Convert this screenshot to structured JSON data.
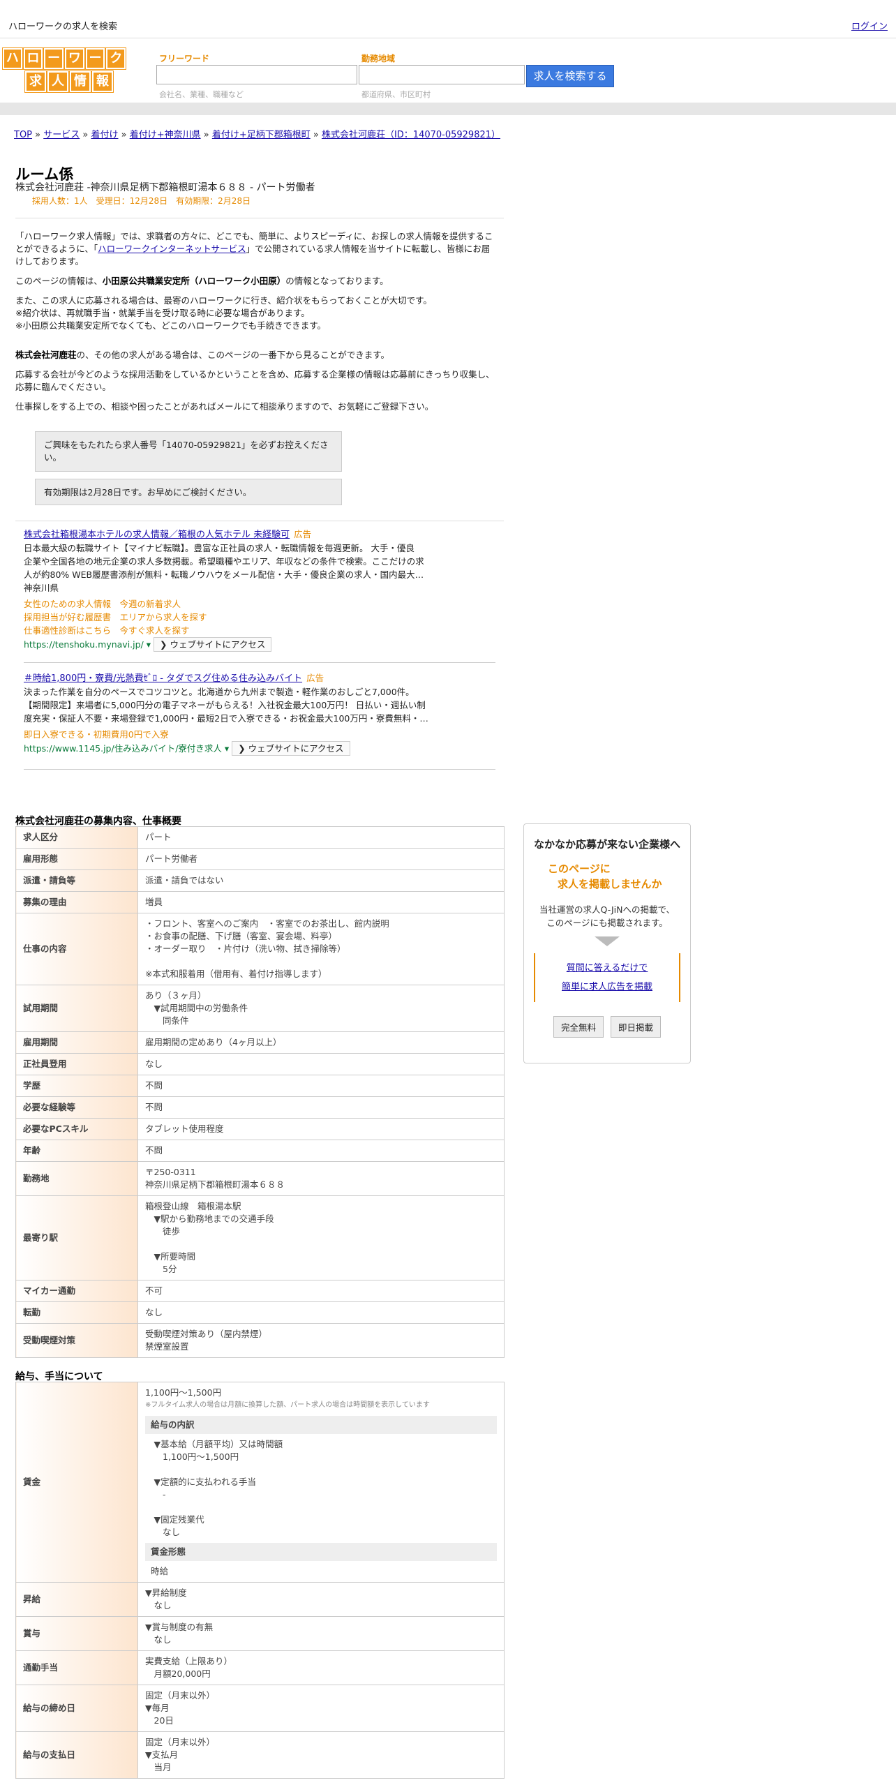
{
  "topbar": {
    "title": "ハローワークの求人を検索",
    "login": "ログイン"
  },
  "logo": {
    "row1": [
      "ハ",
      "ロ",
      "ー",
      "ワ",
      "ー",
      "ク"
    ],
    "row2": [
      "求",
      "人",
      "情",
      "報"
    ]
  },
  "search": {
    "free_label": "フリーワード",
    "free_placeholder": "会社名、業種、職種など",
    "area_label": "勤務地域",
    "area_placeholder": "都道府県、市区町村",
    "button": "求人を検索する"
  },
  "breadcrumb": {
    "items": [
      "TOP",
      "サービス",
      "着付け",
      "着付け+神奈川県",
      "着付け+足柄下郡箱根町",
      "株式会社河鹿荘（ID：14070-05929821）"
    ],
    "sep": " » "
  },
  "job": {
    "title": "ルーム係",
    "subtitle": "株式会社河鹿荘 -神奈川県足柄下郡箱根町湯本６８８ - パート労働者",
    "meta": "採用人数：1人　受理日：12月28日　有効期限：2月28日"
  },
  "intro": {
    "p1a": "「ハローワーク求人情報」では、求職者の方々に、どこでも、簡単に、よりスピーディに、お探しの求人情報を提供することができるように、「",
    "p1link": "ハローワークインターネットサービス",
    "p1b": "」で公開されている求人情報を当サイトに転載し、皆様にお届けしております。",
    "p2a": "このページの情報は、",
    "p2b": "小田原公共職業安定所（ハローワーク小田原）",
    "p2c": "の情報となっております。",
    "p3": [
      "また、この求人に応募される場合は、最寄のハローワークに行き、紹介状をもらっておくことが大切です。",
      "※紹介状は、再就職手当・就業手当を受け取る時に必要な場合があります。",
      "※小田原公共職業安定所でなくても、どこのハローワークでも手続きできます。"
    ],
    "p4a": "株式会社河鹿荘",
    "p4b": "の、その他の求人がある場合は、このページの一番下から見ることができます。",
    "p5": "応募する会社が今どのような採用活動をしているかということを含め、応募する企業様の情報は応募前にきっちり収集し、応募に臨んでください。",
    "p6": "仕事探しをする上での、相談や困ったことがあればメールにて相談承りますので、お気軽にご登録下さい。",
    "note1": "ご興味をもたれたら求人番号「14070-05929821」を必ずお控えください。",
    "note2": "有効期限は2月28日です。お早めにご検討ください。"
  },
  "ads": [
    {
      "title": "株式会社箱根湯本ホテルの求人情報／箱根の人気ホテル 未経験可",
      "tag": "広告",
      "body": [
        "日本最大級の転職サイト【マイナビ転職】。豊富な正社員の求人・転職情報を毎週更新。 大手・優良",
        "企業や全国各地の地元企業の求人多数掲載。希望職種やエリア、年収などの条件で検索。ここだけの求",
        "人が約80% WEB履歴書添削が無料・転職ノウハウをメール配信・大手・優良企業の求人・国内最大…",
        "神奈川県"
      ],
      "links": [
        "女性のための求人情報　今週の新着求人",
        "採用担当が好む履歴書　エリアから求人を探す",
        "仕事適性診断はこちら　今すぐ求人を探す"
      ],
      "url": "https://tenshoku.mynavi.jp/",
      "access": "❯ ウェブサイトにアクセス"
    },
    {
      "title": "＃時給1,800円・寮費/光熱費ｾﾞﾛ - タダでスグ住める住み込みバイト",
      "tag": "広告",
      "body": [
        "決まった作業を自分のペースでコツコツと。北海道から九州まで製造・軽作業のおしごと7,000件。",
        "【期間限定】来場者に5,000円分の電子マネーがもらえる！入社祝金最大100万円！ 日払い・週払い制",
        "度充実・保証人不要・来場登録で1,000円・最短2日で入寮できる・お祝金最大100万円・寮費無料・…"
      ],
      "links": [
        "即日入寮できる・初期費用0円で入寮"
      ],
      "url": "https://www.1145.jp/住み込みバイト/寮付き求人",
      "access": "❯ ウェブサイトにアクセス"
    }
  ],
  "overview": {
    "title": "株式会社河鹿荘の募集内容、仕事概要",
    "rows": [
      {
        "k": "求人区分",
        "v": [
          "パート"
        ]
      },
      {
        "k": "雇用形態",
        "v": [
          "パート労働者"
        ]
      },
      {
        "k": "派遣・請負等",
        "v": [
          "派遣・請負ではない"
        ]
      },
      {
        "k": "募集の理由",
        "v": [
          "増員"
        ]
      },
      {
        "k": "仕事の内容",
        "v": [
          "・フロント、客室へのご案内　・客室でのお茶出し、館内説明",
          "・お食事の配膳、下げ膳（客室、宴会場、料亭）",
          "・オーダー取り　・片付け（洗い物、拭き掃除等）",
          "",
          "※本式和服着用（借用有、着付け指導します）"
        ]
      },
      {
        "k": "試用期間",
        "v": [
          "あり（３ヶ月）",
          "　▼試用期間中の労働条件",
          "　　同条件"
        ]
      },
      {
        "k": "雇用期間",
        "v": [
          "雇用期間の定めあり（4ヶ月以上）"
        ]
      },
      {
        "k": "正社員登用",
        "v": [
          "なし"
        ]
      },
      {
        "k": "学歴",
        "v": [
          "不問"
        ]
      },
      {
        "k": "必要な経験等",
        "v": [
          "不問"
        ]
      },
      {
        "k": "必要なPCスキル",
        "v": [
          "タブレット使用程度"
        ]
      },
      {
        "k": "年齢",
        "v": [
          "不問"
        ]
      },
      {
        "k": "勤務地",
        "v": [
          "〒250-0311",
          "神奈川県足柄下郡箱根町湯本６８８"
        ]
      },
      {
        "k": "最寄り駅",
        "v": [
          "箱根登山線　箱根湯本駅",
          "　▼駅から勤務地までの交通手段",
          "　　徒歩",
          "",
          "　▼所要時間",
          "　　5分"
        ]
      },
      {
        "k": "マイカー通勤",
        "v": [
          "不可"
        ]
      },
      {
        "k": "転勤",
        "v": [
          "なし"
        ]
      },
      {
        "k": "受動喫煙対策",
        "v": [
          "受動喫煙対策あり（屋内禁煙）",
          "禁煙室設置"
        ]
      }
    ]
  },
  "salary": {
    "title": "給与、手当について",
    "wage_k": "賃金",
    "wage_main": "1,100円〜1,500円",
    "wage_note": "※フルタイム求人の場合は月額に換算した額、パート求人の場合は時間額を表示しています",
    "breakdown_label": "給与の内訳",
    "breakdown": [
      "　▼基本給（月額平均）又は時間額",
      "　　1,100円〜1,500円",
      "",
      "　▼定額的に支払われる手当",
      "　　-",
      "",
      "　▼固定残業代",
      "　　なし"
    ],
    "form_label": "賃金形態",
    "form_value": "時給",
    "rows": [
      {
        "k": "昇給",
        "v": [
          "▼昇給制度",
          "　なし"
        ]
      },
      {
        "k": "賞与",
        "v": [
          "▼賞与制度の有無",
          "　なし"
        ]
      },
      {
        "k": "通勤手当",
        "v": [
          "実費支給（上限あり）",
          "　月額20,000円"
        ]
      },
      {
        "k": "給与の締め日",
        "v": [
          "固定（月末以外）",
          "▼毎月",
          "　20日"
        ]
      },
      {
        "k": "給与の支払日",
        "v": [
          "固定（月末以外）",
          "▼支払月",
          "　当月"
        ]
      }
    ]
  },
  "sidebar": {
    "title": "なかなか応募が来ない企業様へ",
    "orange1": "このページに",
    "orange2": "求人を掲載しませんか",
    "p1": "当社運営の求人Q-JiNへの掲載で、",
    "p2": "このページにも掲載されます。",
    "link1": "質問に答えるだけで",
    "link2": "簡単に求人広告を掲載",
    "btn1": "完全無料",
    "btn2": "即日掲載"
  }
}
